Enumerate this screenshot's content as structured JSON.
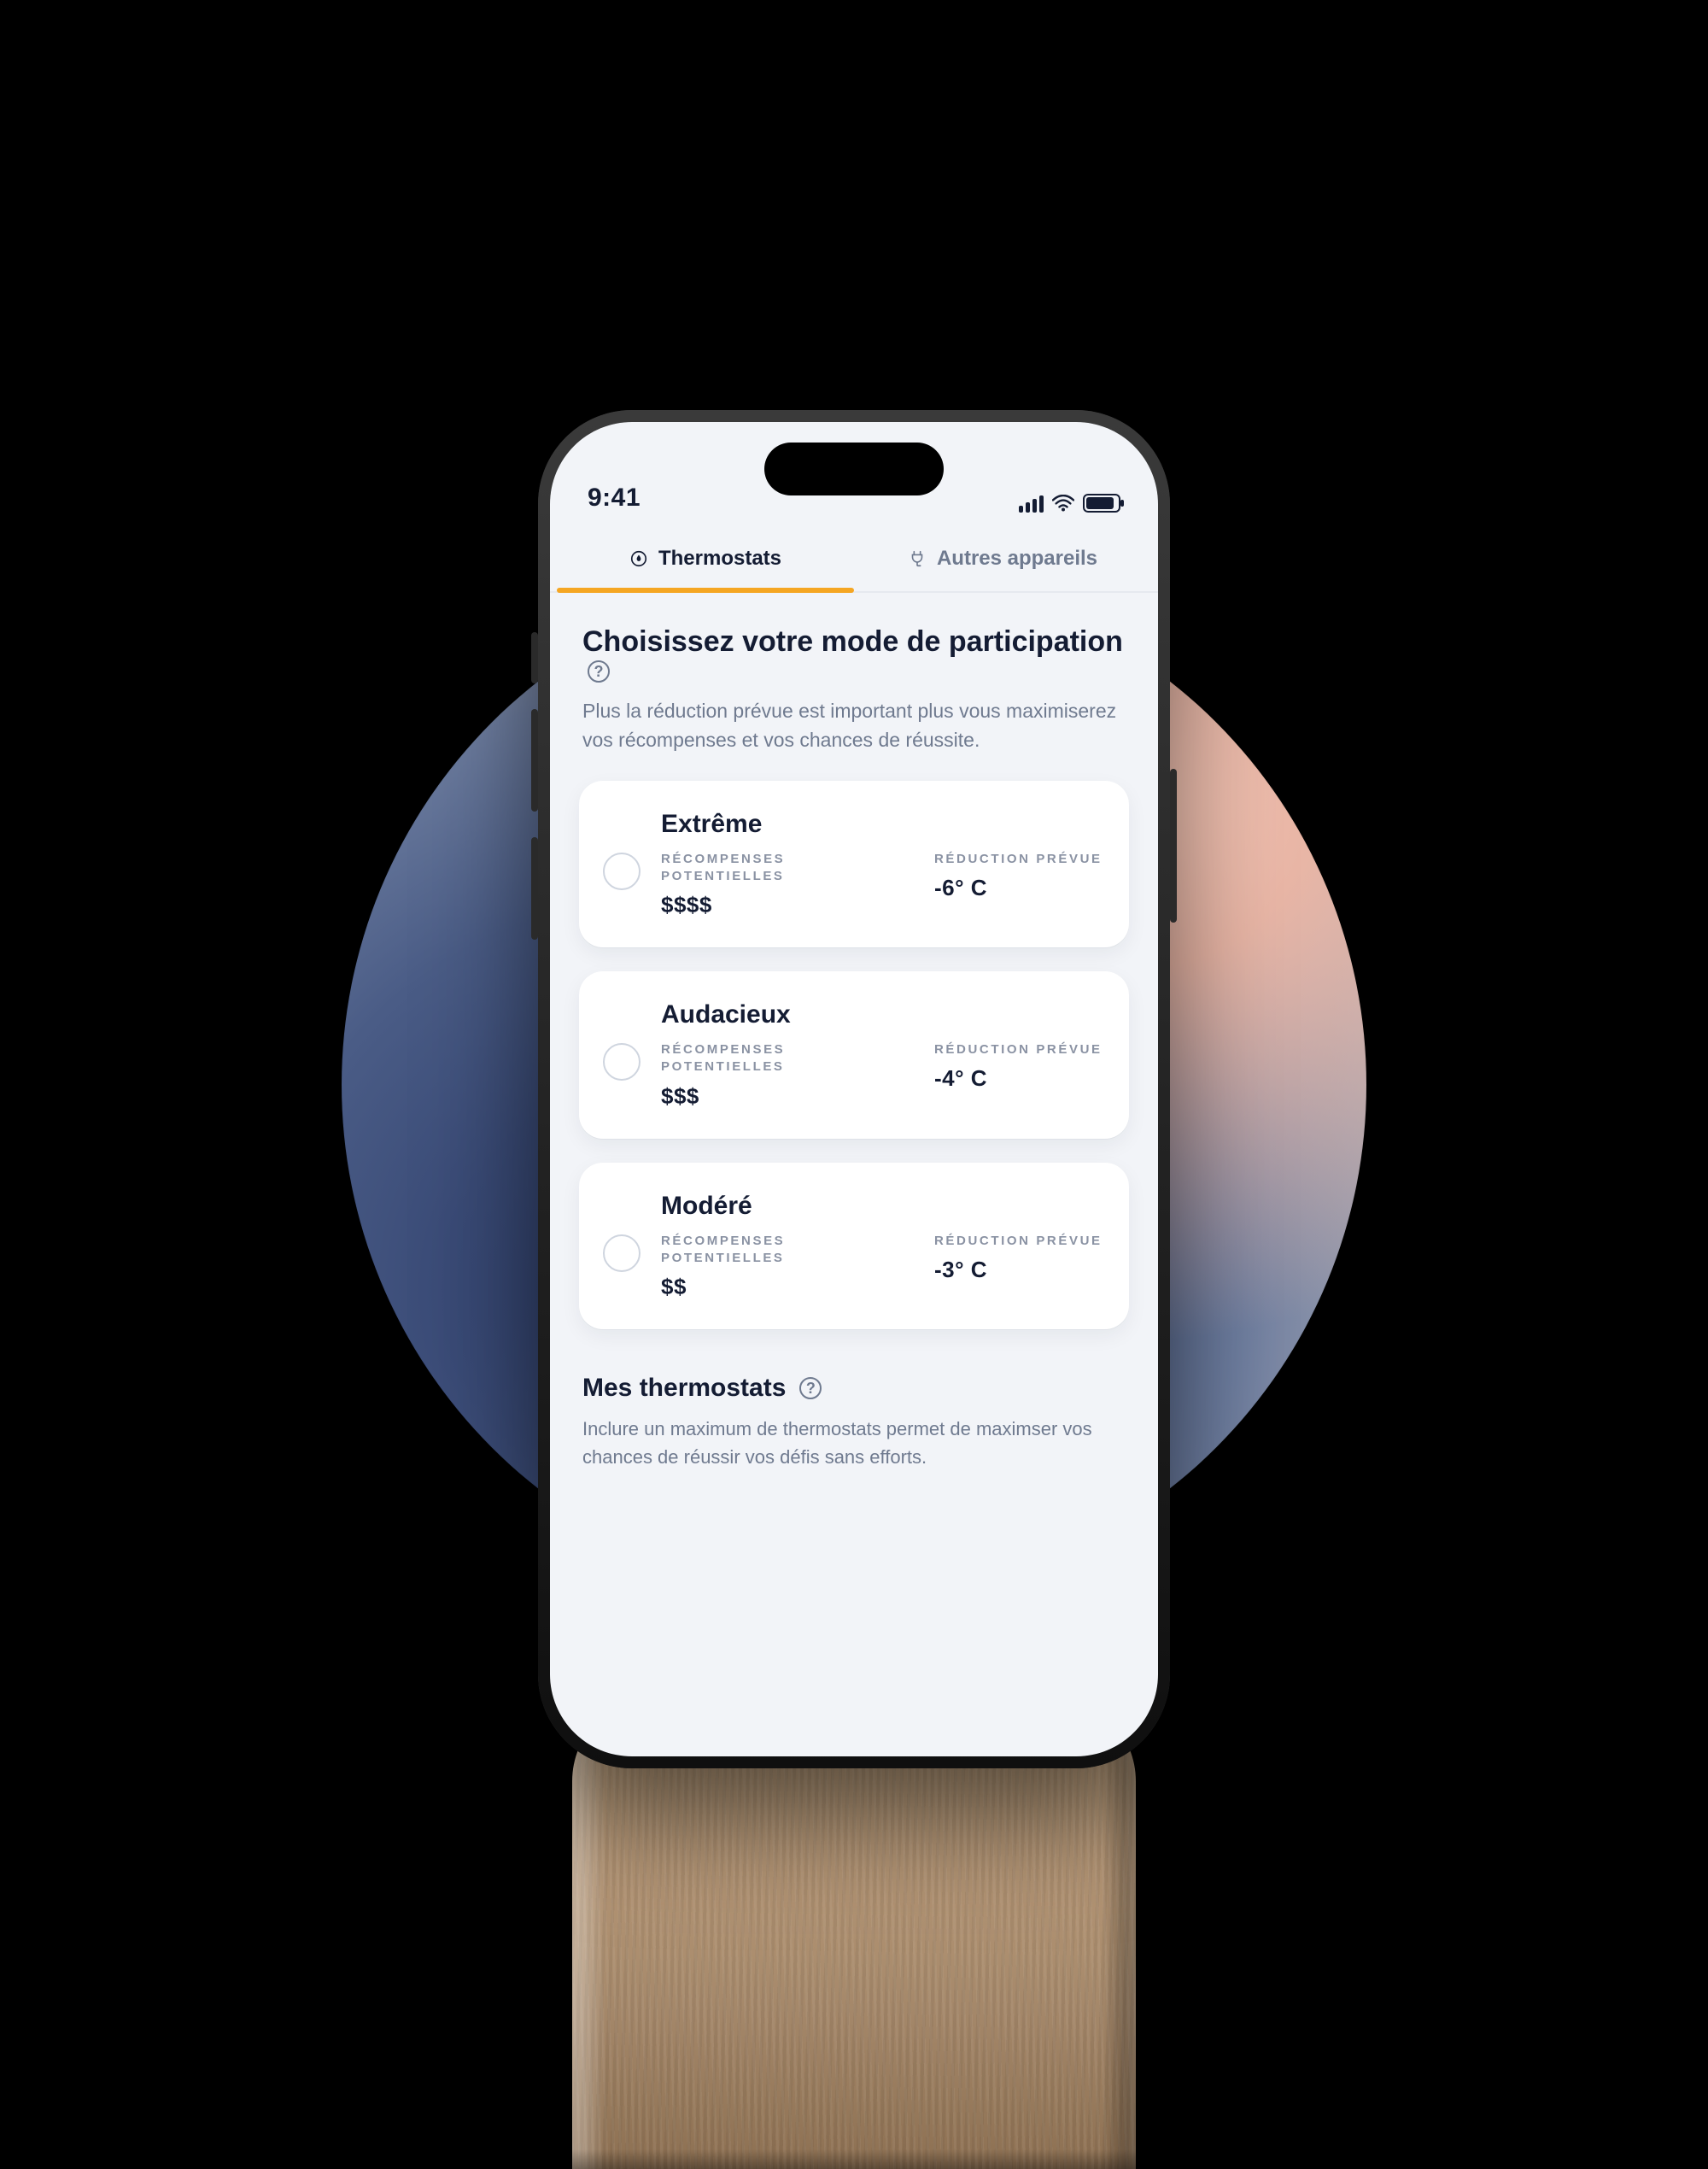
{
  "statusbar": {
    "time": "9:41"
  },
  "tabs": [
    {
      "label": "Thermostats",
      "icon": "thermostat-icon",
      "active": true
    },
    {
      "label": "Autres appareils",
      "icon": "plug-icon",
      "active": false
    }
  ],
  "header": {
    "title": "Choisissez votre mode de participation",
    "subtitle": "Plus la réduction prévue est important plus vous maximiserez vos récompenses et vos chances de réussite."
  },
  "labels": {
    "rewards": "RÉCOMPENSES POTENTIELLES",
    "reduction": "RÉDUCTION PRÉVUE"
  },
  "options": [
    {
      "name": "Extrême",
      "rewards": "$$$$",
      "reduction": "-6° C"
    },
    {
      "name": "Audacieux",
      "rewards": "$$$",
      "reduction": "-4° C"
    },
    {
      "name": "Modéré",
      "rewards": "$$",
      "reduction": "-3° C"
    }
  ],
  "section": {
    "title": "Mes thermostats",
    "desc": "Inclure un maximum de thermostats permet de maximser vos chances de réussir vos défis sans efforts."
  },
  "colors": {
    "accent": "#f5a623",
    "ink": "#1f2a44"
  }
}
